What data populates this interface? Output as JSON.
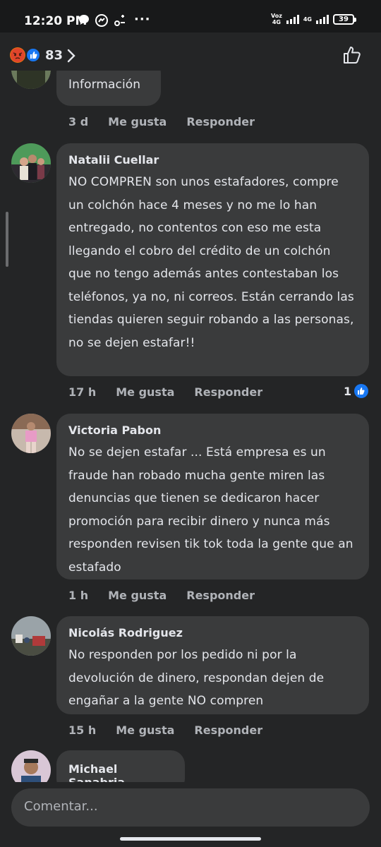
{
  "status_bar": {
    "time": "12:20 PM",
    "network_label_top": "Voz",
    "network_label_bottom": "4G",
    "network2_label": "4G",
    "battery": "39"
  },
  "header": {
    "reaction_count": "83",
    "reaction_icons": [
      "angry-emoji",
      "like-emoji"
    ],
    "like_icon": "thumbs-up-outline-icon"
  },
  "comments": [
    {
      "name": "",
      "text": "Información",
      "time": "3 d",
      "like_label": "Me gusta",
      "reply_label": "Responder"
    },
    {
      "name": "Natalii Cuellar",
      "text": "NO COMPREN son unos estafadores, compre un colchón hace 4 meses y no me lo han entregado, no contentos con eso me esta llegando el cobro del crédito de un colchón que no tengo además antes contestaban los teléfonos, ya no, ni correos. Están cerrando las tiendas quieren seguir robando a las personas, no se dejen estafar!!",
      "time": "17 h",
      "like_label": "Me gusta",
      "reply_label": "Responder",
      "likes": "1"
    },
    {
      "name": "Victoria Pabon",
      "text": "No se dejen estafar ... Está empresa es un fraude han robado mucha gente miren las denuncias que tienen se dedicaron hacer promoción para recibir dinero y nunca más responden revisen tik tok toda la gente que an estafado",
      "time": "1 h",
      "like_label": "Me gusta",
      "reply_label": "Responder"
    },
    {
      "name": "Nicolás Rodriguez",
      "text": "No responden por los pedido ni por la devolución de dinero, respondan dejen de engañar a la gente NO compren",
      "time": "15 h",
      "like_label": "Me gusta",
      "reply_label": "Responder"
    },
    {
      "name": "Michael Sanabria",
      "text": ""
    }
  ],
  "compose": {
    "placeholder": "Comentar..."
  },
  "colors": {
    "background": "#242526",
    "bubble": "#3a3b3c",
    "text": "#e4e6eb",
    "muted": "#b0b3b8",
    "like_blue": "#1877f2"
  }
}
